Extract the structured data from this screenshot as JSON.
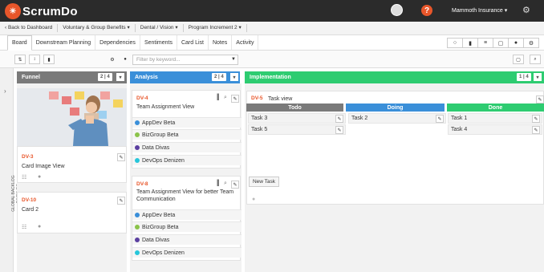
{
  "app": {
    "logo_mark": "☀",
    "logo_text": "ScrumDo",
    "help_glyph": "?",
    "org_name": "Mammoth Insurance",
    "org_caret": "▾",
    "settings_glyph": "⚙"
  },
  "breadcrumbs": [
    {
      "label": "‹ Back to Dashboard"
    },
    {
      "label": "Voluntary & Group Benefits ▾"
    },
    {
      "label": "Dental / Vision ▾"
    },
    {
      "label": "Program Increment 2 ▾"
    }
  ],
  "tabs": [
    "Board",
    "Downstream Planning",
    "Dependencies",
    "Sentiments",
    "Card List",
    "Notes",
    "Activity"
  ],
  "tab_icons": [
    "chat-icon",
    "bar-chart-icon",
    "list-icon",
    "layout-icon",
    "info-icon",
    "settings-icon"
  ],
  "toolbar": {
    "filter_placeholder": "Filter by keyword...",
    "filter_icon": "funnel-icon"
  },
  "backlog": {
    "arrow": "›",
    "label": "GLOBAL BACKLOG   BACKLOG"
  },
  "colors": {
    "funnel": "#7a7a7a",
    "analysis": "#3a8fd9",
    "implementation": "#2ecc71",
    "todo": "#7a7a7a",
    "doing": "#3a8fd9",
    "done": "#2ecc71",
    "accent": "#e8562a"
  },
  "columns": {
    "funnel": {
      "title": "Funnel",
      "count": "2 | 4",
      "caret": "▾"
    },
    "analysis": {
      "title": "Analysis",
      "count": "2 | 4",
      "caret": "▾"
    },
    "implementation": {
      "title": "Implementation",
      "count": "1 | 4",
      "caret": "▾"
    }
  },
  "funnel_cards": [
    {
      "id": "DV-3",
      "title": "Card Image View"
    },
    {
      "id": "DV-10",
      "title": "Card 2"
    }
  ],
  "analysis_cards": [
    {
      "id": "DV-4",
      "title": "Team Assignment View",
      "teams": [
        "AppDev Beta",
        "BizGroup Beta",
        "Data Divas",
        "DevOps Denizen"
      ]
    },
    {
      "id": "DV-8",
      "title": "Team Assignment View for better Team Communication",
      "teams": [
        "AppDev Beta",
        "BizGroup Beta",
        "Data Divas",
        "DevOps Denizen"
      ]
    }
  ],
  "team_colors": [
    "#3a8fd9",
    "#8bc34a",
    "#5b3fa0",
    "#26c6da"
  ],
  "impl_card": {
    "id": "DV-5",
    "title": "Task view"
  },
  "task_columns": [
    "Todo",
    "Doing",
    "Done"
  ],
  "tasks": {
    "todo": [
      "Task 3",
      "Task 5"
    ],
    "doing": [
      "Task 2"
    ],
    "done": [
      "Task 1",
      "Task 4"
    ]
  },
  "new_task_label": "New Task",
  "glyphs": {
    "pencil": "✎",
    "bars": "▐",
    "search": "⌕",
    "clipboard": "☷",
    "comment": "●"
  }
}
